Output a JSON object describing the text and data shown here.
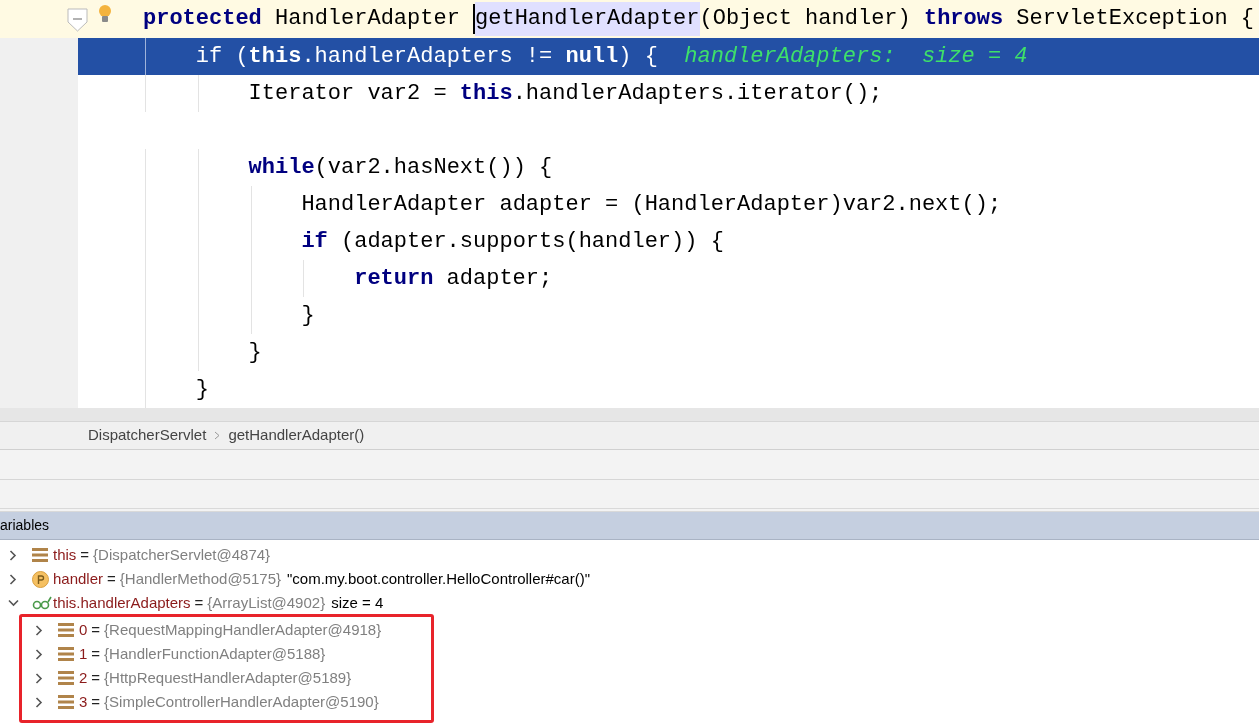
{
  "editor": {
    "lines": [
      {
        "kind": "code",
        "highlighted": false,
        "current": true,
        "tokens": [
          {
            "kind": "keyword",
            "text": "protected"
          },
          {
            "kind": "plain",
            "text": " HandlerAdapter "
          },
          {
            "kind": "usage",
            "text": "getHandlerAdapter"
          },
          {
            "kind": "plain",
            "text": "(Object handler) "
          },
          {
            "kind": "keyword",
            "text": "throws"
          },
          {
            "kind": "plain",
            "text": " ServletException {"
          }
        ],
        "children": [
          {
            "kind": "code",
            "highlighted": true,
            "current": false,
            "tokens": [
              {
                "kind": "plain",
                "text": "if ("
              },
              {
                "kind": "keyword",
                "text": "this"
              },
              {
                "kind": "plain",
                "text": ".handlerAdapters != "
              },
              {
                "kind": "keyword",
                "text": "null"
              },
              {
                "kind": "plain",
                "text": ") {  "
              },
              {
                "kind": "hint",
                "text": "handlerAdapters:  size = 4"
              }
            ],
            "children": [
              {
                "kind": "code",
                "highlighted": false,
                "current": false,
                "tokens": [
                  {
                    "kind": "plain",
                    "text": "Iterator var2 = "
                  },
                  {
                    "kind": "keyword",
                    "text": "this"
                  },
                  {
                    "kind": "plain",
                    "text": ".handlerAdapters.iterator();"
                  }
                ]
              },
              {
                "kind": "blank"
              },
              {
                "kind": "code",
                "highlighted": false,
                "current": false,
                "tokens": [
                  {
                    "kind": "keyword",
                    "text": "while"
                  },
                  {
                    "kind": "plain",
                    "text": "(var2.hasNext()) {"
                  }
                ],
                "children": [
                  {
                    "kind": "code",
                    "highlighted": false,
                    "current": false,
                    "tokens": [
                      {
                        "kind": "plain",
                        "text": "HandlerAdapter adapter = (HandlerAdapter)var2.next();"
                      }
                    ]
                  },
                  {
                    "kind": "code",
                    "highlighted": false,
                    "current": false,
                    "tokens": [
                      {
                        "kind": "keyword",
                        "text": "if"
                      },
                      {
                        "kind": "plain",
                        "text": " (adapter.supports(handler)) {"
                      }
                    ],
                    "children": [
                      {
                        "kind": "code",
                        "highlighted": false,
                        "current": false,
                        "tokens": [
                          {
                            "kind": "keyword",
                            "text": "return"
                          },
                          {
                            "kind": "plain",
                            "text": " adapter;"
                          }
                        ]
                      }
                    ]
                  },
                  {
                    "kind": "code",
                    "highlighted": false,
                    "current": false,
                    "tokens": [
                      {
                        "kind": "plain",
                        "text": "}"
                      }
                    ]
                  }
                ]
              },
              {
                "kind": "code",
                "highlighted": false,
                "current": false,
                "tokens": [
                  {
                    "kind": "plain",
                    "text": "}"
                  }
                ]
              }
            ]
          },
          {
            "kind": "code",
            "highlighted": false,
            "current": false,
            "tokens": [
              {
                "kind": "plain",
                "text": "}"
              }
            ]
          }
        ]
      }
    ]
  },
  "breadcrumb": [
    "DispatcherServlet",
    "getHandlerAdapter()"
  ],
  "variables": {
    "title": "ariables",
    "items": [
      {
        "kind": "field",
        "name": "this",
        "separator": "=",
        "value": "{DispatcherServlet@4874}",
        "expanded": false
      },
      {
        "kind": "parameter",
        "name": "handler",
        "separator": "=",
        "value": "{HandlerMethod@5175}",
        "extra": "\"com.my.boot.controller.HelloController#car()\"",
        "expanded": false
      },
      {
        "kind": "watch",
        "name": "this.handlerAdapters",
        "separator": "=",
        "value": "{ArrayList@4902}",
        "extra": "size = 4",
        "expanded": true,
        "children_framed": true,
        "children": [
          {
            "kind": "field",
            "name": "0",
            "separator": "=",
            "value": "{RequestMappingHandlerAdapter@4918}",
            "expanded": false
          },
          {
            "kind": "field",
            "name": "1",
            "separator": "=",
            "value": "{HandlerFunctionAdapter@5188}",
            "expanded": false
          },
          {
            "kind": "field",
            "name": "2",
            "separator": "=",
            "value": "{HttpRequestHandlerAdapter@5189}",
            "expanded": false
          },
          {
            "kind": "field",
            "name": "3",
            "separator": "=",
            "value": "{SimpleControllerHandlerAdapter@5190}",
            "expanded": false
          }
        ]
      }
    ]
  }
}
